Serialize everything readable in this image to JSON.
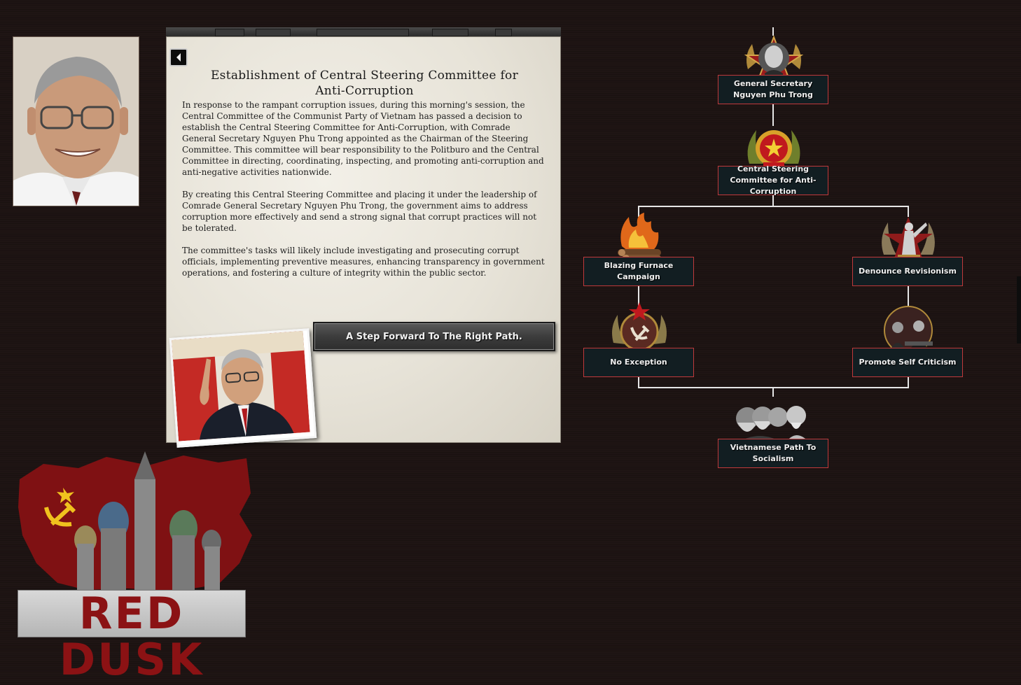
{
  "event": {
    "title": "Establishment of Central Steering Committee for Anti-Corruption",
    "paragraphs": [
      "In response to the rampant corruption issues, during this morning's session, the Central Committee of the Communist Party of Vietnam has passed a decision to establish the Central Steering Committee for Anti-Corruption, with Comrade General Secretary Nguyen Phu Trong appointed as the Chairman of the Steering Committee. This committee will bear responsibility to the Politburo and the Central Committee in directing, coordinating, inspecting, and promoting anti-corruption and anti-negative activities nationwide.",
      "By creating this Central Steering Committee and placing it under the leadership of Comrade General Secretary Nguyen Phu Trong, the government aims to address corruption more effectively and send a strong signal that corrupt practices will not be tolerated.",
      "The committee's tasks will likely include investigating and prosecuting corrupt officials, implementing preventive measures, enhancing transparency in government operations, and fostering a culture of integrity within the public sector."
    ],
    "option_label": "A Step Forward To The Right Path.",
    "back_icon": "back-arrow-icon"
  },
  "focus_tree": {
    "nodes": [
      {
        "id": "gen-sec",
        "label": "General Secretary Nguyen Phu Trong",
        "icon": "portrait-medal-icon"
      },
      {
        "id": "steering",
        "label": "Central Steering Committee for Anti-Corruption",
        "icon": "emblem-wreath-icon"
      },
      {
        "id": "furnace",
        "label": "Blazing Furnace Campaign",
        "icon": "burning-logs-icon"
      },
      {
        "id": "revisionism",
        "label": "Denounce Revisionism",
        "icon": "lenin-statue-icon"
      },
      {
        "id": "no-exception",
        "label": "No Exception",
        "icon": "hammer-sickle-medal-icon"
      },
      {
        "id": "self-criticism",
        "label": "Promote Self Criticism",
        "icon": "meeting-photo-icon"
      },
      {
        "id": "viet-path",
        "label": "Vietnamese Path To Socialism",
        "icon": "communist-leaders-icon"
      }
    ]
  },
  "logo": {
    "text": "RED DUSK"
  },
  "colors": {
    "background": "#1f1514",
    "label_border": "#c0393b",
    "label_bg": "#121e22",
    "connector": "#e6e6e6",
    "logo_red": "#8b1214"
  }
}
